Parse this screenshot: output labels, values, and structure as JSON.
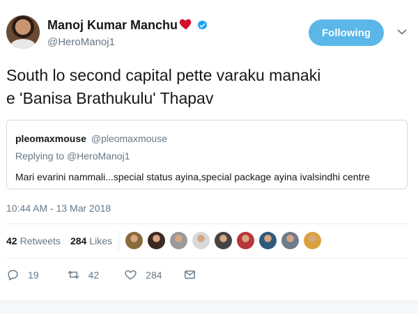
{
  "user": {
    "name": "Manoj Kumar Manchu",
    "handle": "@HeroManoj1",
    "verified_color": "#1da1f2"
  },
  "follow_button": {
    "label": "Following",
    "color": "#5ab7e8"
  },
  "tweet": {
    "text_line1": "South lo second capital pette varaku manaki",
    "text_line2": "e 'Banisa Brathukulu' Thapav"
  },
  "quoted_tweet": {
    "name": "pleomaxmouse",
    "handle": "@pleomaxmouse",
    "replying_prefix": "Replying to",
    "replying_handle": "@HeroManoj1",
    "text": "Mari evarini nammali...special status ayina,special package ayina ivalsindhi centre"
  },
  "timestamp": "10:44 AM - 13 Mar 2018",
  "stats": {
    "retweets_count": "42",
    "retweets_label": "Retweets",
    "likes_count": "284",
    "likes_label": "Likes"
  },
  "liker_avatars": [
    {
      "icon": "avatar-1",
      "color": "#8a6a3c"
    },
    {
      "icon": "avatar-2",
      "color": "#3a2a22"
    },
    {
      "icon": "avatar-3",
      "color": "#9a9a9a"
    },
    {
      "icon": "avatar-4",
      "color": "#d8d8d8"
    },
    {
      "icon": "avatar-5",
      "color": "#444444"
    },
    {
      "icon": "avatar-6",
      "color": "#b8373c"
    },
    {
      "icon": "avatar-7",
      "color": "#2f5a7a"
    },
    {
      "icon": "avatar-8",
      "color": "#6f7a8a"
    },
    {
      "icon": "avatar-9",
      "color": "#d9a13a"
    }
  ],
  "actions": {
    "reply_count": "19",
    "retweet_count": "42",
    "like_count": "284"
  }
}
